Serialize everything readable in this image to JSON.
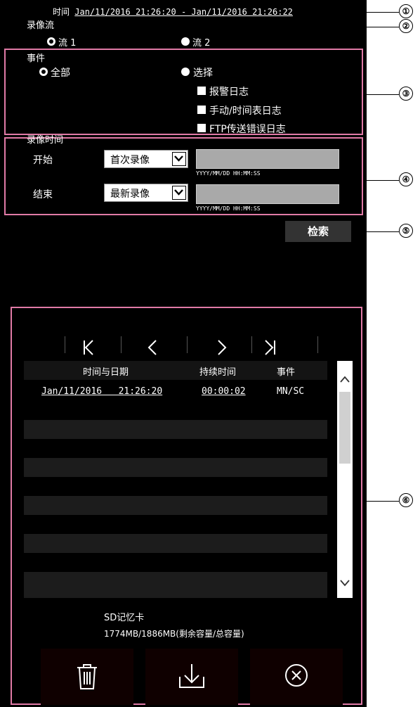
{
  "time_header": {
    "label": "时间",
    "range": "Jan/11/2016 21:26:20 - Jan/11/2016 21:26:22"
  },
  "stream": {
    "title": "录像流",
    "options": [
      "流 1",
      "流 2"
    ],
    "selected": "流 1"
  },
  "events": {
    "title": "事件",
    "all_label": "全部",
    "select_label": "选择",
    "checkboxes": [
      "报警日志",
      "手动/时间表日志",
      "FTP传送错误日志"
    ]
  },
  "record_time": {
    "title": "录像时间",
    "start": {
      "label": "开始",
      "select_value": "首次录像",
      "input_value": "",
      "hint": "YYYY/MM/DD HH:MM:SS"
    },
    "end": {
      "label": "结束",
      "select_value": "最新录像",
      "input_value": "",
      "hint": "YYYY/MM/DD HH:MM:SS"
    }
  },
  "search_button": "检索",
  "result_list": {
    "nav_icons": [
      "first-page-icon",
      "previous-page-icon",
      "next-page-icon",
      "last-page-icon"
    ],
    "columns": [
      "时间与日期",
      "持续时间",
      "事件"
    ],
    "rows": [
      {
        "datetime": "Jan/11/2016   21:26:20",
        "duration": "00:00:02",
        "event": "MN/SC"
      }
    ]
  },
  "sd_card": {
    "title": "SD记忆卡",
    "capacity": "1774MB/1886MB(剩余容量/总容量)"
  },
  "action_icons": [
    "delete-icon",
    "download-icon",
    "cancel-icon"
  ],
  "callouts": [
    "①",
    "②",
    "③",
    "④",
    "⑤",
    "⑥"
  ],
  "colors": {
    "background": "#000000",
    "callout_frame": "#e07aa6",
    "field": "#a9a9a9",
    "row_alt": "#1c1c1c",
    "button": "#333333"
  }
}
